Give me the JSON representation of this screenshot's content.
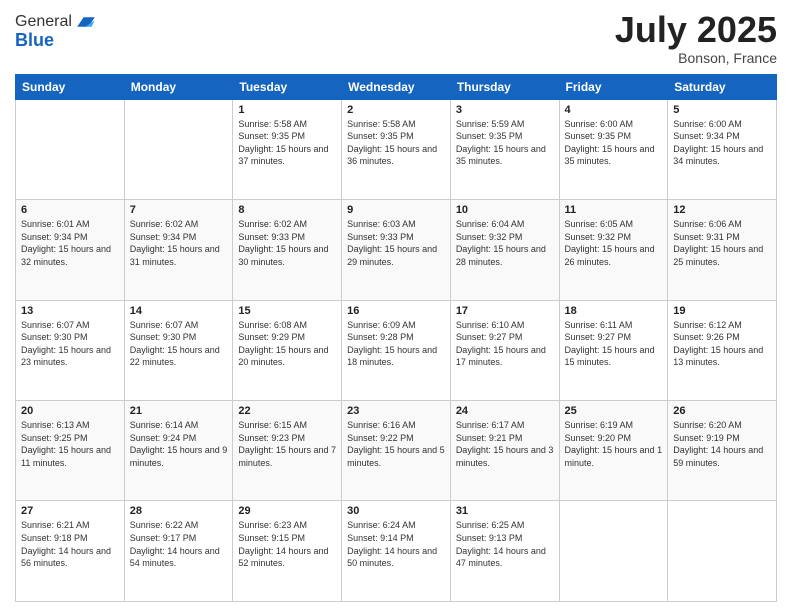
{
  "header": {
    "logo_general": "General",
    "logo_blue": "Blue",
    "month_year": "July 2025",
    "location": "Bonson, France"
  },
  "days_of_week": [
    "Sunday",
    "Monday",
    "Tuesday",
    "Wednesday",
    "Thursday",
    "Friday",
    "Saturday"
  ],
  "weeks": [
    [
      {
        "day": "",
        "info": ""
      },
      {
        "day": "",
        "info": ""
      },
      {
        "day": "1",
        "info": "Sunrise: 5:58 AM\nSunset: 9:35 PM\nDaylight: 15 hours and 37 minutes."
      },
      {
        "day": "2",
        "info": "Sunrise: 5:58 AM\nSunset: 9:35 PM\nDaylight: 15 hours and 36 minutes."
      },
      {
        "day": "3",
        "info": "Sunrise: 5:59 AM\nSunset: 9:35 PM\nDaylight: 15 hours and 35 minutes."
      },
      {
        "day": "4",
        "info": "Sunrise: 6:00 AM\nSunset: 9:35 PM\nDaylight: 15 hours and 35 minutes."
      },
      {
        "day": "5",
        "info": "Sunrise: 6:00 AM\nSunset: 9:34 PM\nDaylight: 15 hours and 34 minutes."
      }
    ],
    [
      {
        "day": "6",
        "info": "Sunrise: 6:01 AM\nSunset: 9:34 PM\nDaylight: 15 hours and 32 minutes."
      },
      {
        "day": "7",
        "info": "Sunrise: 6:02 AM\nSunset: 9:34 PM\nDaylight: 15 hours and 31 minutes."
      },
      {
        "day": "8",
        "info": "Sunrise: 6:02 AM\nSunset: 9:33 PM\nDaylight: 15 hours and 30 minutes."
      },
      {
        "day": "9",
        "info": "Sunrise: 6:03 AM\nSunset: 9:33 PM\nDaylight: 15 hours and 29 minutes."
      },
      {
        "day": "10",
        "info": "Sunrise: 6:04 AM\nSunset: 9:32 PM\nDaylight: 15 hours and 28 minutes."
      },
      {
        "day": "11",
        "info": "Sunrise: 6:05 AM\nSunset: 9:32 PM\nDaylight: 15 hours and 26 minutes."
      },
      {
        "day": "12",
        "info": "Sunrise: 6:06 AM\nSunset: 9:31 PM\nDaylight: 15 hours and 25 minutes."
      }
    ],
    [
      {
        "day": "13",
        "info": "Sunrise: 6:07 AM\nSunset: 9:30 PM\nDaylight: 15 hours and 23 minutes."
      },
      {
        "day": "14",
        "info": "Sunrise: 6:07 AM\nSunset: 9:30 PM\nDaylight: 15 hours and 22 minutes."
      },
      {
        "day": "15",
        "info": "Sunrise: 6:08 AM\nSunset: 9:29 PM\nDaylight: 15 hours and 20 minutes."
      },
      {
        "day": "16",
        "info": "Sunrise: 6:09 AM\nSunset: 9:28 PM\nDaylight: 15 hours and 18 minutes."
      },
      {
        "day": "17",
        "info": "Sunrise: 6:10 AM\nSunset: 9:27 PM\nDaylight: 15 hours and 17 minutes."
      },
      {
        "day": "18",
        "info": "Sunrise: 6:11 AM\nSunset: 9:27 PM\nDaylight: 15 hours and 15 minutes."
      },
      {
        "day": "19",
        "info": "Sunrise: 6:12 AM\nSunset: 9:26 PM\nDaylight: 15 hours and 13 minutes."
      }
    ],
    [
      {
        "day": "20",
        "info": "Sunrise: 6:13 AM\nSunset: 9:25 PM\nDaylight: 15 hours and 11 minutes."
      },
      {
        "day": "21",
        "info": "Sunrise: 6:14 AM\nSunset: 9:24 PM\nDaylight: 15 hours and 9 minutes."
      },
      {
        "day": "22",
        "info": "Sunrise: 6:15 AM\nSunset: 9:23 PM\nDaylight: 15 hours and 7 minutes."
      },
      {
        "day": "23",
        "info": "Sunrise: 6:16 AM\nSunset: 9:22 PM\nDaylight: 15 hours and 5 minutes."
      },
      {
        "day": "24",
        "info": "Sunrise: 6:17 AM\nSunset: 9:21 PM\nDaylight: 15 hours and 3 minutes."
      },
      {
        "day": "25",
        "info": "Sunrise: 6:19 AM\nSunset: 9:20 PM\nDaylight: 15 hours and 1 minute."
      },
      {
        "day": "26",
        "info": "Sunrise: 6:20 AM\nSunset: 9:19 PM\nDaylight: 14 hours and 59 minutes."
      }
    ],
    [
      {
        "day": "27",
        "info": "Sunrise: 6:21 AM\nSunset: 9:18 PM\nDaylight: 14 hours and 56 minutes."
      },
      {
        "day": "28",
        "info": "Sunrise: 6:22 AM\nSunset: 9:17 PM\nDaylight: 14 hours and 54 minutes."
      },
      {
        "day": "29",
        "info": "Sunrise: 6:23 AM\nSunset: 9:15 PM\nDaylight: 14 hours and 52 minutes."
      },
      {
        "day": "30",
        "info": "Sunrise: 6:24 AM\nSunset: 9:14 PM\nDaylight: 14 hours and 50 minutes."
      },
      {
        "day": "31",
        "info": "Sunrise: 6:25 AM\nSunset: 9:13 PM\nDaylight: 14 hours and 47 minutes."
      },
      {
        "day": "",
        "info": ""
      },
      {
        "day": "",
        "info": ""
      }
    ]
  ]
}
